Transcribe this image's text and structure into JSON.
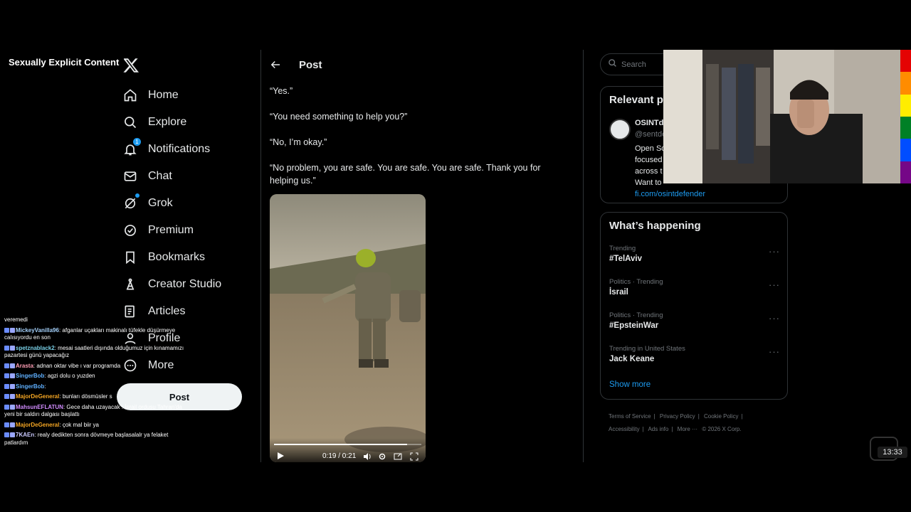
{
  "overlay": {
    "explicit_label": "Sexually Explicit Content",
    "timer": "13:33"
  },
  "nav": {
    "items": [
      {
        "label": "Home",
        "icon": "home-icon"
      },
      {
        "label": "Explore",
        "icon": "search-icon"
      },
      {
        "label": "Notifications",
        "icon": "bell-icon",
        "badge": "1"
      },
      {
        "label": "Chat",
        "icon": "mail-icon"
      },
      {
        "label": "Grok",
        "icon": "grok-icon"
      },
      {
        "label": "Premium",
        "icon": "verified-icon"
      },
      {
        "label": "Bookmarks",
        "icon": "bookmark-icon"
      },
      {
        "label": "Creator Studio",
        "icon": "creator-studio-icon"
      },
      {
        "label": "Articles",
        "icon": "articles-icon"
      },
      {
        "label": "Profile",
        "icon": "profile-icon"
      },
      {
        "label": "More",
        "icon": "more-icon"
      }
    ],
    "post_button": "Post"
  },
  "chat": [
    {
      "user": "MickeyVanilla96",
      "msg": "afganlar uçakları makinalı tüfekle düşürmeye calısıyordu en son",
      "color": "#a7d4ff"
    },
    {
      "user": "spetznablack2",
      "msg": "mesai saatleri dışında olduğumuz için kınamamızı pazartesi günü yapacağız",
      "color": "#7ad1e8"
    },
    {
      "user": "Arasta",
      "msg": "adnan oktar vibe ı var programda",
      "color": "#ff9eb5"
    },
    {
      "user": "SingerBob",
      "msg": "agzi dolu o yuzden",
      "color": "#5fb0ff"
    },
    {
      "user": "SingerBob",
      "msg": "",
      "color": "#5fb0ff"
    },
    {
      "user": "MajorDeGeneral",
      "msg": "bunları dösmüsler s",
      "color": "#f5a623"
    },
    {
      "user": "MahsunEFLATUN",
      "msg": "Gece daha uzayacak : İsrail ordusu Tahran'da yeni bir saldırı dalgası başlattı",
      "color": "#d18cff"
    },
    {
      "user": "MajorDeGeneral",
      "msg": "çok mal biir ya",
      "color": "#f5a623"
    },
    {
      "user": "7KAEn",
      "msg": "realy dedikten sonra dövmeye başlasalalr ya felaket patlardım",
      "color": "#c9c9ff"
    }
  ],
  "chat_top_fragment": "veremedi",
  "main": {
    "header_title": "Post",
    "paragraphs": [
      "“Yes.”",
      "“You need something to help you?”",
      "“No, I’m okay.”",
      "“No problem, you are safe. You are safe. You are safe. Thank you for helping us.”"
    ],
    "video": {
      "time": "0:19 / 0:21",
      "progress": 0.905
    }
  },
  "right": {
    "search_placeholder": "Search",
    "relevant": {
      "title": "Relevant p",
      "name": "OSINTd",
      "handle": "@sentde",
      "bio_lines": [
        "Open So",
        "focused",
        "across t",
        "Want to"
      ],
      "link": "fi.com/osintdefender"
    },
    "happening": {
      "title": "What’s happening",
      "trends": [
        {
          "meta": "Trending",
          "name": "#TelAviv"
        },
        {
          "meta": "Politics · Trending",
          "name": "İsrail"
        },
        {
          "meta": "Politics · Trending",
          "name": "#EpsteinWar"
        },
        {
          "meta": "Trending in United States",
          "name": "Jack Keane"
        }
      ],
      "show_more": "Show more"
    },
    "footer": [
      "Terms of Service",
      "|",
      "Privacy Policy",
      "|",
      "Cookie Policy",
      "|",
      "Accessibility",
      "|",
      "Ads info",
      "|",
      "More ···",
      "© 2026 X Corp."
    ]
  },
  "colors": {
    "accent": "#1d9bf0",
    "background": "#000000",
    "border": "#2f3336",
    "muted": "#71767b"
  },
  "rainbow": [
    "#e40303",
    "#ff8c00",
    "#ffed00",
    "#008026",
    "#004dff",
    "#750787"
  ]
}
